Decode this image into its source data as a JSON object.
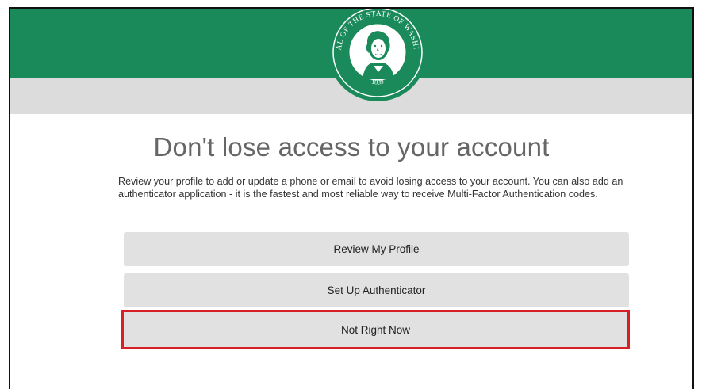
{
  "header": {
    "seal": {
      "text_top": "THE SEAL OF THE STATE OF WASHINGTON",
      "year": "1889",
      "colors": {
        "ring": "#1a8a5a",
        "inner": "#ffffff"
      }
    },
    "colors": {
      "banner": "#1a8a5a",
      "band": "#dcdcdc"
    }
  },
  "main": {
    "title": "Don't lose access to your account",
    "description": "Review your profile to add or update a phone or email to avoid losing access to your account. You can also add an authenticator application - it is the fastest and most reliable way to receive Multi-Factor Authentication codes.",
    "buttons": {
      "review_profile": "Review My Profile",
      "setup_authenticator": "Set Up Authenticator",
      "not_right_now": "Not Right Now"
    },
    "highlight_color": "#d81f26"
  }
}
